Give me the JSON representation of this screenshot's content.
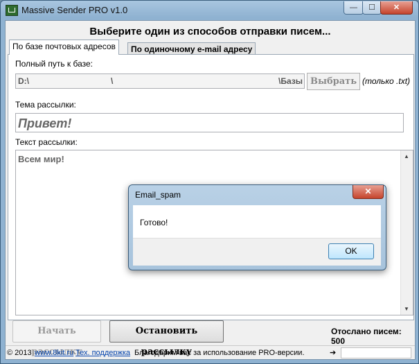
{
  "window": {
    "title": "Massive Sender PRO v1.0",
    "min_glyph": "—",
    "max_glyph": "☐",
    "close_glyph": "✕"
  },
  "main": {
    "heading": "Выберите один из способов отправки писем...",
    "tabs": [
      {
        "label": "По базе почтовых адресов",
        "active": true
      },
      {
        "label": "По одиночному e-mail адресу",
        "active": false
      }
    ],
    "db_path_label": "Полный путь к базе:",
    "db_path": {
      "left": "D:\\",
      "middle": "\\",
      "right": "\\Базы"
    },
    "choose_button": "Выбрать",
    "only_txt_note": "(только .txt)",
    "subject_label": "Тема рассылки:",
    "subject_value": "Привет!",
    "body_label": "Текст рассылки:",
    "body_value": "Всем мир!",
    "start_button": "Начать рассылку",
    "stop_button": "Остановить рассылку",
    "sent_status": "Отослано писем: 500"
  },
  "statusbar": {
    "copyright": "© 2013",
    "site_link": "www.8kit.ru",
    "support_link": "Тех. поддержка",
    "thanks": "Благодарим вас за использование PRO-версии.",
    "arrow": "➔"
  },
  "dialog": {
    "title": "Email_spam",
    "message": "Готово!",
    "ok_button": "OK",
    "close_glyph": "✕"
  }
}
